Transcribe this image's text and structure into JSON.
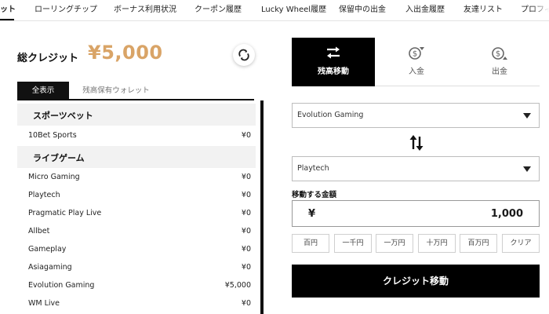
{
  "top_nav": {
    "items": [
      "ット",
      "ローリングチップ",
      "ボーナス利用状況",
      "クーポン履歴",
      "Lucky Wheel履歴",
      "保留中の出金",
      "入出金履歴",
      "友達リスト",
      "プロフィ"
    ]
  },
  "summary": {
    "total_label": "総クレジット",
    "total_value": "¥5,000"
  },
  "wallet_tabs": [
    "全表示",
    "残高保有ウォレット"
  ],
  "sections": {
    "sports": {
      "title": "スポーツベット",
      "rows": [
        {
          "name": "10Bet Sports",
          "amount": "¥0"
        }
      ]
    },
    "live": {
      "title": "ライブゲーム",
      "rows": [
        {
          "name": "Micro Gaming",
          "amount": "¥0"
        },
        {
          "name": "Playtech",
          "amount": "¥0"
        },
        {
          "name": "Pragmatic Play Live",
          "amount": "¥0"
        },
        {
          "name": "Allbet",
          "amount": "¥0"
        },
        {
          "name": "Gameplay",
          "amount": "¥0"
        },
        {
          "name": "Asiagaming",
          "amount": "¥0"
        },
        {
          "name": "Evolution Gaming",
          "amount": "¥5,000"
        },
        {
          "name": "WM Live",
          "amount": "¥0"
        }
      ]
    }
  },
  "action_tabs": [
    {
      "label": "残高移動",
      "icon": "transfer-arrows-icon"
    },
    {
      "label": "入金",
      "icon": "deposit-dollar-icon"
    },
    {
      "label": "出金",
      "icon": "withdraw-dollar-icon"
    }
  ],
  "transfer": {
    "from_wallet": "Evolution Gaming",
    "to_wallet": "Playtech",
    "amount_label": "移動する金額",
    "currency_symbol": "¥",
    "amount": "1,000",
    "quick_amounts": [
      "百円",
      "一千円",
      "一万円",
      "十万円",
      "百万円",
      "クリア"
    ],
    "submit_label": "クレジット移動"
  },
  "colors": {
    "accent_gold": "#d9a467",
    "primary_dark": "#000000",
    "section_bg": "#f2f2f2"
  }
}
